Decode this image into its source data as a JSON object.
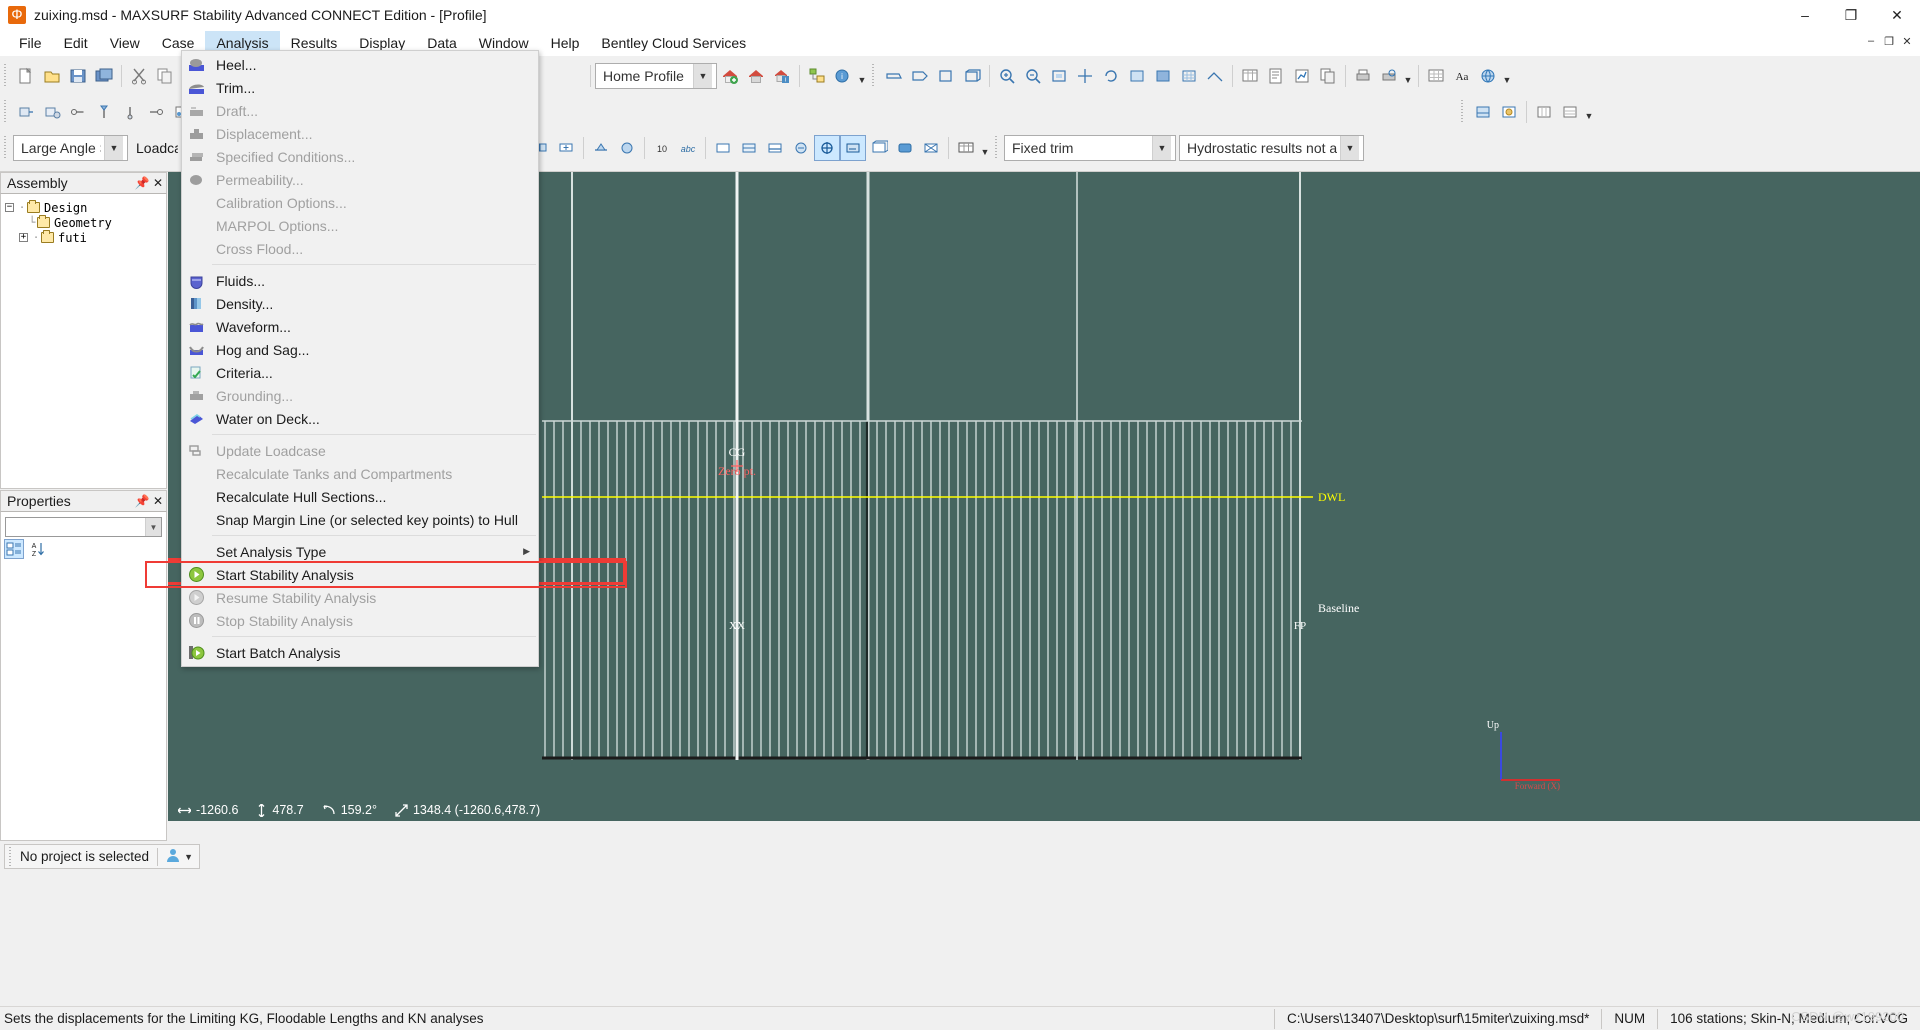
{
  "window": {
    "title": "zuixing.msd - MAXSURF Stability Advanced CONNECT Edition - [Profile]",
    "app_icon": "maxsurf-icon",
    "minimize": "–",
    "maximize": "❐",
    "close": "✕",
    "mdi_minimize": "–",
    "mdi_restore": "❐",
    "mdi_close": "✕"
  },
  "menubar": {
    "items": [
      {
        "label": "File",
        "active": false
      },
      {
        "label": "Edit",
        "active": false
      },
      {
        "label": "View",
        "active": false
      },
      {
        "label": "Case",
        "active": false
      },
      {
        "label": "Analysis",
        "active": true
      },
      {
        "label": "Results",
        "active": false
      },
      {
        "label": "Display",
        "active": false
      },
      {
        "label": "Data",
        "active": false
      },
      {
        "label": "Window",
        "active": false
      },
      {
        "label": "Help",
        "active": false
      },
      {
        "label": "Bentley Cloud Services",
        "active": false
      }
    ]
  },
  "analysis_menu": {
    "groups": [
      {
        "items": [
          {
            "label": "Heel...",
            "enabled": true,
            "icon": "heel-icon"
          },
          {
            "label": "Trim...",
            "enabled": true,
            "icon": "trim-icon"
          },
          {
            "label": "Draft...",
            "enabled": false,
            "icon": "draft-icon"
          },
          {
            "label": "Displacement...",
            "enabled": false,
            "icon": "displacement-icon"
          },
          {
            "label": "Specified Conditions...",
            "enabled": false,
            "icon": "specified-conditions-icon"
          },
          {
            "label": "Permeability...",
            "enabled": false,
            "icon": "permeability-icon"
          },
          {
            "label": "Calibration Options...",
            "enabled": false,
            "icon": ""
          },
          {
            "label": "MARPOL Options...",
            "enabled": false,
            "icon": ""
          },
          {
            "label": "Cross Flood...",
            "enabled": false,
            "icon": ""
          }
        ]
      },
      {
        "items": [
          {
            "label": "Fluids...",
            "enabled": true,
            "icon": "fluids-icon"
          },
          {
            "label": "Density...",
            "enabled": true,
            "icon": "density-icon"
          },
          {
            "label": "Waveform...",
            "enabled": true,
            "icon": "waveform-icon"
          },
          {
            "label": "Hog and Sag...",
            "enabled": true,
            "icon": "hog-sag-icon"
          },
          {
            "label": "Criteria...",
            "enabled": true,
            "icon": "criteria-icon"
          },
          {
            "label": "Grounding...",
            "enabled": false,
            "icon": "grounding-icon"
          },
          {
            "label": "Water on Deck...",
            "enabled": true,
            "icon": "water-on-deck-icon"
          }
        ]
      },
      {
        "items": [
          {
            "label": "Update Loadcase",
            "enabled": false,
            "icon": "update-loadcase-icon"
          },
          {
            "label": "Recalculate Tanks and Compartments",
            "enabled": false,
            "icon": ""
          },
          {
            "label": "Recalculate Hull Sections...",
            "enabled": true,
            "icon": ""
          },
          {
            "label": "Snap Margin Line (or selected key points) to Hull",
            "enabled": true,
            "icon": ""
          }
        ]
      },
      {
        "items": [
          {
            "label": "Set Analysis Type",
            "enabled": true,
            "icon": "",
            "submenu": true
          },
          {
            "label": "Start Stability Analysis",
            "enabled": true,
            "icon": "start-analysis-icon",
            "highlighted": true
          },
          {
            "label": "Resume Stability Analysis",
            "enabled": false,
            "icon": "resume-analysis-icon"
          },
          {
            "label": "Stop Stability Analysis",
            "enabled": false,
            "icon": "stop-analysis-icon"
          }
        ]
      },
      {
        "items": [
          {
            "label": "Start Batch Analysis",
            "enabled": true,
            "icon": "start-batch-icon"
          }
        ]
      }
    ]
  },
  "toolbars": {
    "analysis_mode": {
      "value": "Large Angle Stab",
      "placeholder": "Large Angle Stab"
    },
    "loadcase_label": "Loadcase",
    "home_profile": {
      "value": "Home Profile",
      "placeholder": "Home Profile"
    },
    "trim_mode": {
      "value": "Fixed trim",
      "placeholder": "Fixed trim"
    },
    "hydrostatics": {
      "value": "Hydrostatic results not ava",
      "placeholder": "Hydrostatic results not ava"
    }
  },
  "assembly_panel": {
    "title": "Assembly",
    "pin_icon": "pin-icon",
    "close_icon": "close-icon",
    "tree": [
      {
        "label": "Design",
        "level": 0,
        "expander": "-",
        "has_expander": true
      },
      {
        "label": "Geometry",
        "level": 1,
        "expander": "",
        "has_expander": false
      },
      {
        "label": "futi",
        "level": 1,
        "expander": "+",
        "has_expander": true
      }
    ]
  },
  "properties_panel": {
    "title": "Properties",
    "pin_icon": "pin-icon",
    "close_icon": "close-icon",
    "search_value": "",
    "search_placeholder": "",
    "tools": [
      {
        "name": "categorized-button",
        "active": true
      },
      {
        "name": "alphabetical-sort-button",
        "active": false
      }
    ]
  },
  "canvas": {
    "background_color": "#466560",
    "labels": {
      "dwl": "DWL",
      "baseline": "Baseline",
      "cg": "CG",
      "zero_point": "Zero pt.",
      "station": "XX",
      "fp": "FP",
      "axis_up": "Up",
      "axis_fwd": "Forward (X)"
    },
    "colors": {
      "dwl_line": "#ffff00",
      "zero_point": "#ff6161",
      "station_lines": "#d8e2e0",
      "baseline": "#1b1b1b",
      "highlight_rect": "#ef3b35"
    }
  },
  "coordbar": {
    "x_icon": "horizontal-arrow-icon",
    "x_value": "-1260.6",
    "y_icon": "vertical-arrow-icon",
    "y_value": "478.7",
    "angle_icon": "angle-icon",
    "angle_value": "159.2°",
    "dist_icon": "distance-icon",
    "dist_value": "1348.4 (-1260.6,478.7)"
  },
  "project_bar": {
    "text": "No project is selected",
    "user_icon": "user-icon",
    "dropdown_icon": "chevron-down-icon"
  },
  "statusbar": {
    "hint": "Sets the displacements for the Limiting KG, Floodable Lengths and KN analyses",
    "file_path": "C:\\Users\\13407\\Desktop\\surf\\15miter\\zuixing.msd*",
    "num_indicator": "NUM",
    "model_info": "106 stations; Skin-N; Medium; Cor.VCG",
    "watermark": "CSDN @wz199200"
  }
}
